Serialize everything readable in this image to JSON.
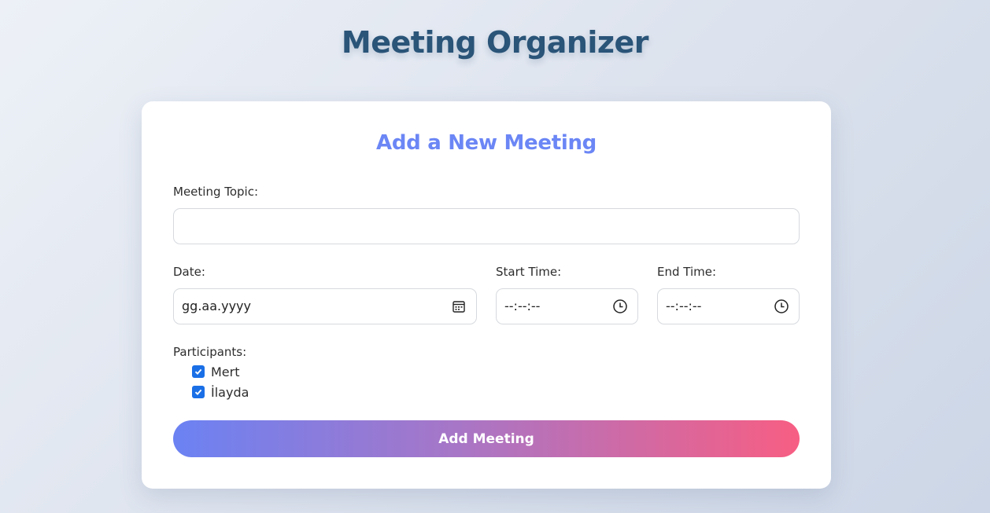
{
  "page": {
    "title": "Meeting Organizer"
  },
  "form": {
    "title": "Add a New Meeting",
    "topic": {
      "label": "Meeting Topic:",
      "value": ""
    },
    "date": {
      "label": "Date:",
      "placeholder": "gg.aa.yyyy",
      "icon": "calendar-icon"
    },
    "start_time": {
      "label": "Start Time:",
      "placeholder": "--:--:--",
      "icon": "clock-icon"
    },
    "end_time": {
      "label": "End Time:",
      "placeholder": "--:--:--",
      "icon": "clock-icon"
    },
    "participants": {
      "label": "Participants:",
      "items": [
        {
          "name": "Mert",
          "checked": true
        },
        {
          "name": "İlayda",
          "checked": true
        }
      ]
    },
    "submit_label": "Add Meeting"
  },
  "colors": {
    "page_title": "#2a5478",
    "form_title": "#6b86f5",
    "checkbox": "#1a6fe6",
    "button_gradient_start": "#6b82f3",
    "button_gradient_end": "#f75e83"
  }
}
